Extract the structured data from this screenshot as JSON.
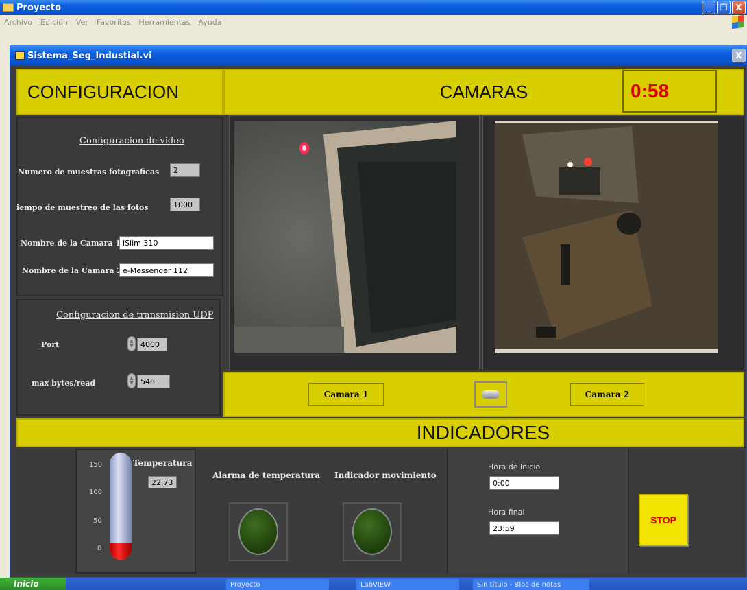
{
  "outer_window": {
    "title": "Proyecto",
    "menu": [
      "Archivo",
      "Edición",
      "Ver",
      "Favoritos",
      "Herramientas",
      "Ayuda"
    ],
    "buttons": {
      "minimize": "_",
      "restore": "❐",
      "close": "X"
    }
  },
  "vi_window": {
    "title": "Sistema_Seg_Industial.vi",
    "close": "X"
  },
  "headers": {
    "configuracion": "CONFIGURACION",
    "camaras": "CAMARAS",
    "indicadores": "INDICADORES",
    "timer": "0:58"
  },
  "video_config": {
    "title": "Configuracion de video",
    "samples_label": "Numero de muestras fotograficas",
    "samples_value": "2",
    "period_label": "iempo de muestreo de las fotos",
    "period_value": "1000",
    "cam1_label": "Nombre de la Camara 1",
    "cam1_value": "iSlim 310",
    "cam2_label": "Nombre de la Camara 2",
    "cam2_value": "e-Messenger 112"
  },
  "udp_config": {
    "title": "Configuracion de transmision UDP",
    "port_label": "Port",
    "port_value": "4000",
    "bytes_label": "max bytes/read",
    "bytes_value": "548"
  },
  "cameras": {
    "cam1_button": "Camara 1",
    "cam2_button": "Camara 2"
  },
  "indicators": {
    "temperature_label": "Temperatura",
    "temperature_value": "22,73",
    "temperature_level": 22.73,
    "scale_ticks": [
      "150",
      "100",
      "50",
      "0"
    ],
    "alarm_label": "Alarma de temperatura",
    "motion_label": "Indicador movimiento",
    "start_label": "Hora de Inicio",
    "start_value": "0:00",
    "end_label": "Hora final",
    "end_value": "23:59",
    "stop_button": "STOP"
  },
  "taskbar": {
    "start": "Inicio",
    "items": [
      "Proyecto",
      "LabVIEW",
      "Sin título - Bloc de notas"
    ]
  },
  "colors": {
    "header_yellow": "#d9cf00",
    "panel_dark": "#3a3a3a",
    "timer_red": "#e00000",
    "xp_blue": "#0a5fe0"
  }
}
